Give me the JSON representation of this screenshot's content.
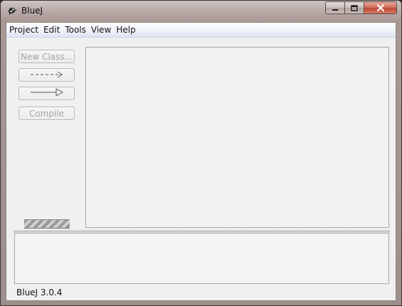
{
  "window": {
    "title": "BlueJ",
    "app_icon": "bluej-bird-icon",
    "controls": {
      "minimize_icon": "minimize-icon",
      "maximize_icon": "maximize-icon",
      "close_icon": "close-icon"
    },
    "colors": {
      "frame": "#a79894",
      "client": "#f0f0f0",
      "close_button": "#c94d38"
    }
  },
  "menubar": {
    "items": [
      "Project",
      "Edit",
      "Tools",
      "View",
      "Help"
    ]
  },
  "toolbar": {
    "new_class_label": "New Class...",
    "new_uses_arrow_icon": "dashed-arrow-icon",
    "new_inherits_arrow_icon": "inheritance-arrow-icon",
    "compile_label": "Compile"
  },
  "status": {
    "text": "BlueJ 3.0.4"
  }
}
